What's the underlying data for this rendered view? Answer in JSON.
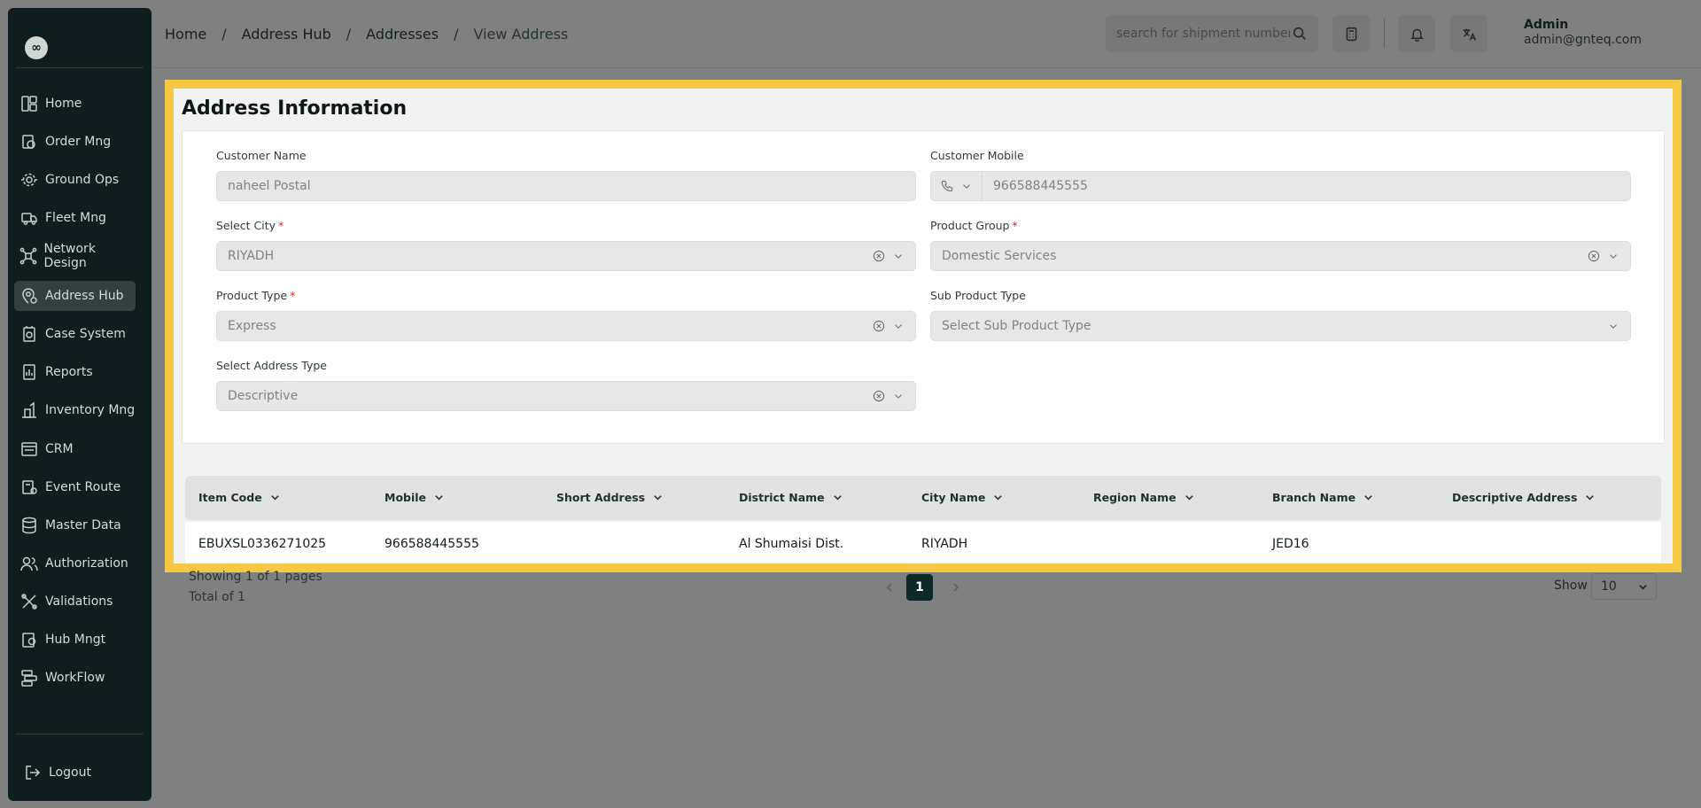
{
  "colors": {
    "sidebar_bg": "#0e1e1e",
    "highlight": "#f6c945",
    "active_nav": "#33403f",
    "pagination_active": "#0e2a28"
  },
  "logo": {
    "glyph": "∞"
  },
  "sidebar": {
    "items": [
      {
        "label": "Home",
        "icon": "dashboard-icon"
      },
      {
        "label": "Order Mng",
        "icon": "box-icon"
      },
      {
        "label": "Ground Ops",
        "icon": "radar-icon"
      },
      {
        "label": "Fleet Mng",
        "icon": "truck-icon"
      },
      {
        "label": "Network Design",
        "icon": "network-icon"
      },
      {
        "label": "Address Hub",
        "icon": "map-pin-icon",
        "active": true
      },
      {
        "label": "Case System",
        "icon": "case-icon"
      },
      {
        "label": "Reports",
        "icon": "report-icon"
      },
      {
        "label": "Inventory Mng",
        "icon": "inventory-icon"
      },
      {
        "label": "CRM",
        "icon": "crm-icon"
      },
      {
        "label": "Event Route",
        "icon": "route-icon"
      },
      {
        "label": "Master Data",
        "icon": "database-icon"
      },
      {
        "label": "Authorization",
        "icon": "users-icon"
      },
      {
        "label": "Validations",
        "icon": "tools-icon"
      },
      {
        "label": "Hub Mngt",
        "icon": "hub-icon"
      },
      {
        "label": "WorkFlow",
        "icon": "workflow-icon"
      }
    ],
    "logout": "Logout"
  },
  "breadcrumb": [
    "Home",
    "Address Hub",
    "Addresses",
    "View Address"
  ],
  "breadcrumb_sep": "/",
  "header": {
    "search_placeholder": "search for shipment number",
    "user_name": "Admin",
    "user_email": "admin@gnteq.com"
  },
  "form": {
    "title": "Address Information",
    "customer_name_label": "Customer Name",
    "customer_name_value": "naheel Postal",
    "customer_mobile_label": "Customer Mobile",
    "customer_mobile_value": "966588445555",
    "city_label": "Select City",
    "city_value": "RIYADH",
    "product_group_label": "Product Group",
    "product_group_value": "Domestic Services",
    "product_type_label": "Product Type",
    "product_type_value": "Express",
    "sub_product_type_label": "Sub Product Type",
    "sub_product_type_placeholder": "Select Sub Product Type",
    "address_type_label": "Select Address Type",
    "address_type_value": "Descriptive",
    "required_mark": "*"
  },
  "table": {
    "columns": [
      "Item Code",
      "Mobile",
      "Short Address",
      "District Name",
      "City Name",
      "Region Name",
      "Branch Name",
      "Descriptive Address"
    ],
    "rows": [
      [
        "EBUXSL0336271025",
        "966588445555",
        "",
        "Al Shumaisi Dist.",
        "RIYADH",
        "",
        "JED16",
        ""
      ]
    ]
  },
  "pagination": {
    "showing": "Showing 1 of 1 pages",
    "total": "Total of 1",
    "current_page": "1",
    "show_label": "Show",
    "page_size": "10"
  }
}
